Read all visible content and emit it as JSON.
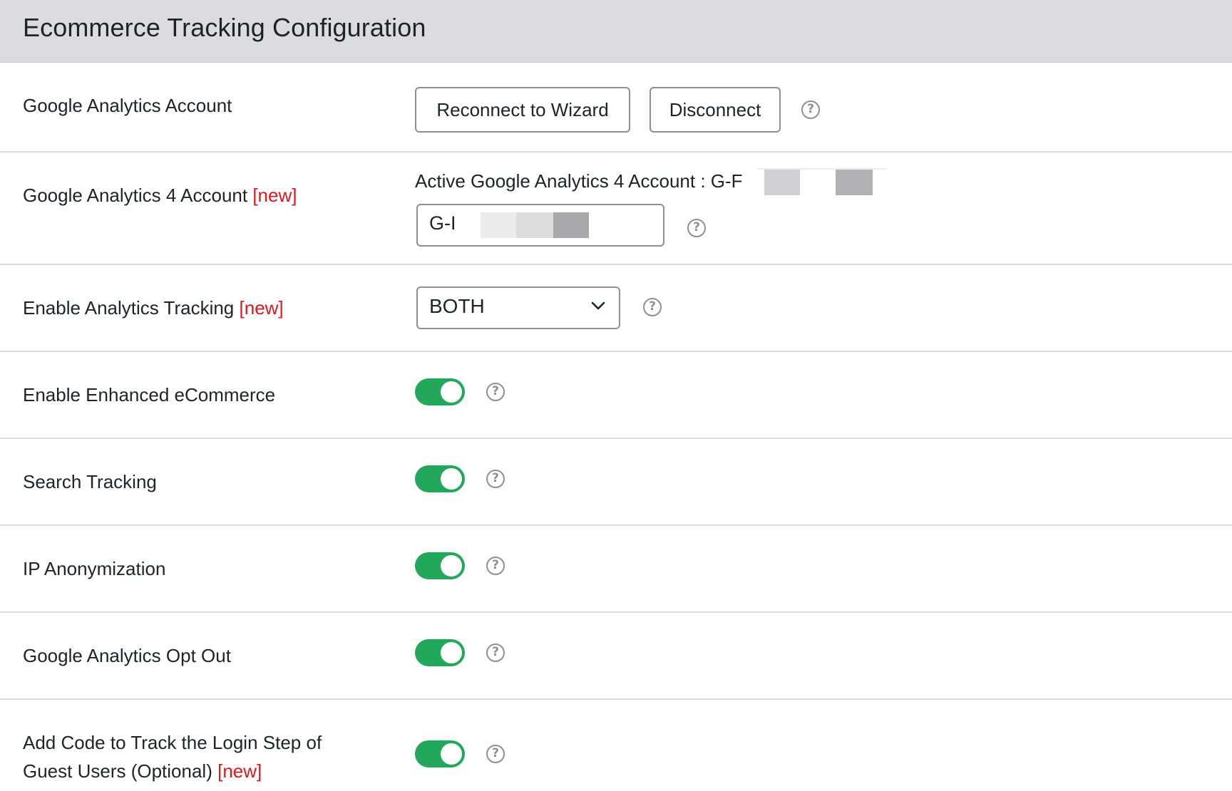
{
  "header": {
    "title": "Ecommerce Tracking Configuration"
  },
  "new_tag": "[new]",
  "help_glyph": "?",
  "rows": {
    "ga_account": {
      "label": "Google Analytics Account",
      "reconnect_button": "Reconnect to Wizard",
      "disconnect_button": "Disconnect"
    },
    "ga4_account": {
      "label": "Google Analytics 4 Account",
      "active_text": "Active Google Analytics 4 Account : G-F",
      "input_value": "G-I"
    },
    "analytics_tracking": {
      "label": "Enable Analytics Tracking",
      "selected_value": "BOTH"
    },
    "enhanced_ecommerce": {
      "label": "Enable Enhanced eCommerce",
      "enabled": true
    },
    "search_tracking": {
      "label": "Search Tracking",
      "enabled": true
    },
    "ip_anonymization": {
      "label": "IP Anonymization",
      "enabled": true
    },
    "opt_out": {
      "label": "Google Analytics Opt Out",
      "enabled": true
    },
    "login_step": {
      "label_line1": "Add Code to Track the Login Step of",
      "label_line2": "Guest Users (Optional)",
      "enabled": true
    }
  },
  "colors": {
    "toggle_on": "#22a85a",
    "new_tag": "#e2161c",
    "header_bg": "#dcdcde"
  },
  "icons": {
    "help": "help-circle-icon",
    "select_arrow": "chevron-down-icon"
  }
}
